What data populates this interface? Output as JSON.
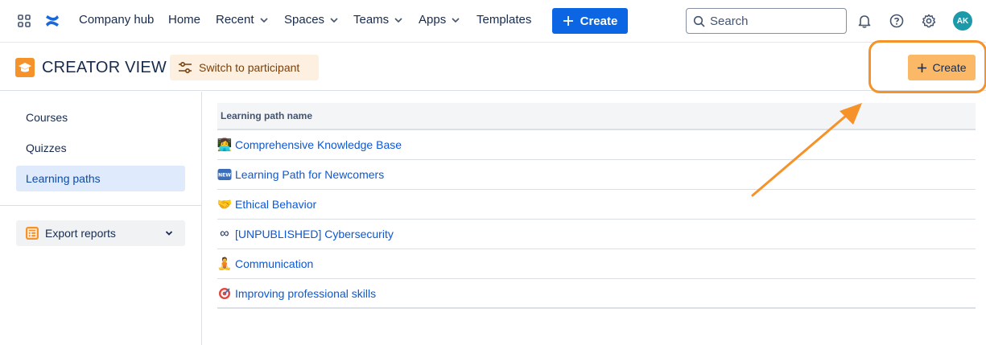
{
  "nav": {
    "company_hub": "Company hub",
    "home": "Home",
    "recent": "Recent",
    "spaces": "Spaces",
    "teams": "Teams",
    "apps": "Apps",
    "templates": "Templates",
    "create_label": "Create",
    "search_placeholder": "Search",
    "avatar_initials": "AK"
  },
  "header": {
    "title": "CREATOR VIEW",
    "switch_label": "Switch to participant",
    "create_label": "Create"
  },
  "sidebar": {
    "items": [
      {
        "label": "Courses"
      },
      {
        "label": "Quizzes"
      },
      {
        "label": "Learning paths",
        "active": true
      }
    ],
    "export_label": "Export reports"
  },
  "table": {
    "header": "Learning path name",
    "rows": [
      {
        "icon": "woman-technologist-emoji",
        "name": "Comprehensive Knowledge Base"
      },
      {
        "icon": "new-button-emoji",
        "name": "Learning Path for Newcomers"
      },
      {
        "icon": "handshake-emoji",
        "name": "Ethical Behavior"
      },
      {
        "icon": "infinity-emoji",
        "name": "[UNPUBLISHED] Cybersecurity"
      },
      {
        "icon": "person-lotus-emoji",
        "name": "Communication"
      },
      {
        "icon": "direct-hit-emoji",
        "name": "Improving professional skills"
      }
    ]
  },
  "colors": {
    "primary": "#0c66e4",
    "accent_orange": "#f5922a",
    "create_orange": "#fbb866",
    "active_bg": "#dfeafd",
    "link": "#0c58d6"
  }
}
